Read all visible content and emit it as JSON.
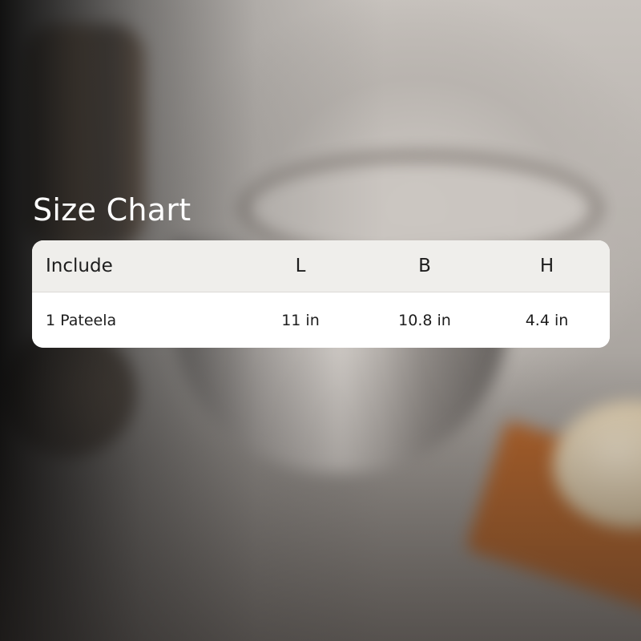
{
  "title": "Size Chart",
  "table": {
    "headers": [
      "Include",
      "L",
      "B",
      "H"
    ],
    "rows": [
      [
        "1 Pateela",
        "11 in",
        "10.8 in",
        "4.4 in"
      ]
    ]
  },
  "colors": {
    "title_text": "#ffffff",
    "header_bg": "#efeeeb",
    "body_bg": "#ffffff",
    "cell_text": "#1d1d1d"
  }
}
